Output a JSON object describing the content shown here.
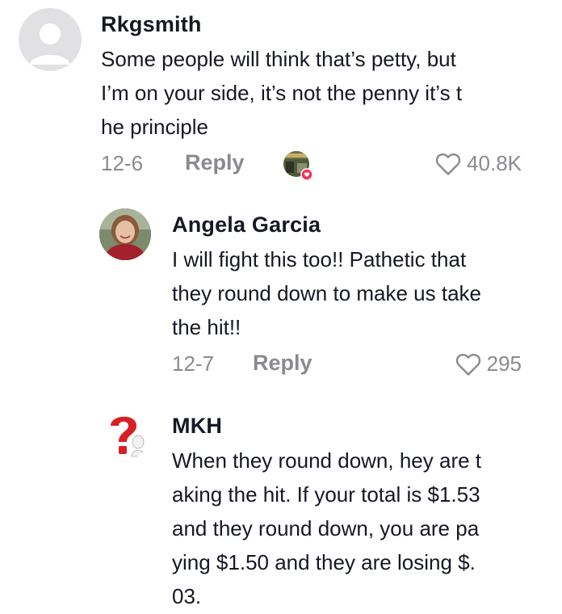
{
  "comments": [
    {
      "username": "Rkgsmith",
      "lines": [
        "Some people will think that’s petty, but",
        "I’m on your side, it’s not the penny it’s t",
        "he principle"
      ],
      "date": "12-6",
      "reply_label": "Reply",
      "likes": "40.8K",
      "avatar_icon": "default-avatar-icon",
      "liked_by_creator": true
    },
    {
      "username": "Angela Garcia",
      "lines": [
        "I will fight this too!! Pathetic that",
        "they round down to make us take",
        "the hit!!"
      ],
      "date": "12-7",
      "reply_label": "Reply",
      "likes": "295",
      "avatar_icon": "profile-photo-avatar"
    },
    {
      "username": "MKH",
      "lines": [
        "When they round down, hey are t",
        "aking the hit. If your total is $1.53",
        "and they round down, you are pa",
        "ying $1.50 and they are losing $.",
        "03."
      ],
      "avatar_icon": "red-question-mark-avatar"
    }
  ],
  "colors": {
    "text": "#161823",
    "muted": "#8a8b91",
    "accent": "#fe2c55"
  }
}
